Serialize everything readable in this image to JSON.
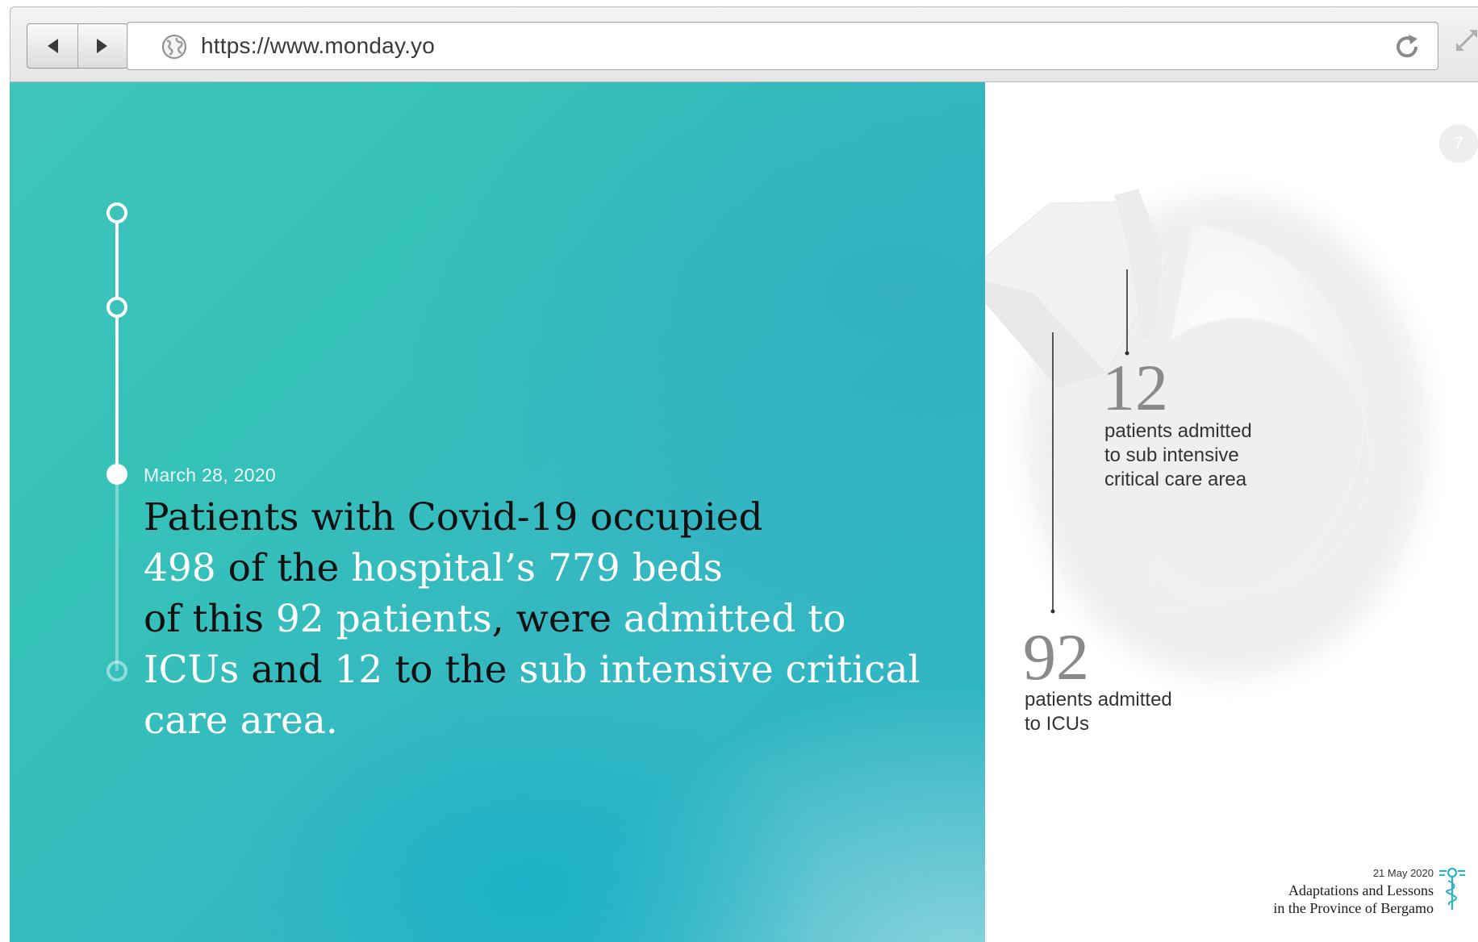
{
  "browser": {
    "url": "https://www.monday.yo",
    "back_label": "back",
    "forward_label": "forward"
  },
  "slide": {
    "page_number": "7",
    "date": "March 28, 2020",
    "headline": {
      "line1": [
        {
          "text": "Patients with Covid-19 occupied",
          "highlight": false
        }
      ],
      "line2": [
        {
          "text": "498",
          "highlight": true
        },
        {
          "text": " of the ",
          "highlight": false
        },
        {
          "text": "hospital’s 779 beds",
          "highlight": true
        }
      ],
      "line3": [
        {
          "text": "of this ",
          "highlight": false
        },
        {
          "text": "92 patients",
          "highlight": true
        },
        {
          "text": ", were ",
          "highlight": false
        },
        {
          "text": "admitted to",
          "highlight": true
        }
      ],
      "line4": [
        {
          "text": "ICUs",
          "highlight": true
        },
        {
          "text": " and ",
          "highlight": false
        },
        {
          "text": "12",
          "highlight": true
        },
        {
          "text": " to the ",
          "highlight": false
        },
        {
          "text": "sub intensive critical",
          "highlight": true
        }
      ],
      "line5": [
        {
          "text": "care area.",
          "highlight": true
        }
      ]
    },
    "stats": [
      {
        "number": "12",
        "lines": [
          "patients admitted",
          "to sub intensive",
          "critical care area"
        ]
      },
      {
        "number": "92",
        "lines": [
          "patients admitted",
          "to ICUs"
        ]
      }
    ],
    "footer": {
      "date": "21 May 2020",
      "title_line1": "Adaptations and Lessons",
      "title_line2": "in the Province of Bergamo"
    }
  },
  "colors": {
    "teal_start": "#3fc4bc",
    "teal_end": "#2fb4c4",
    "highlight_text": "#ffffff",
    "dark_text": "#111111",
    "accent_logo": "#2bb3c0"
  }
}
